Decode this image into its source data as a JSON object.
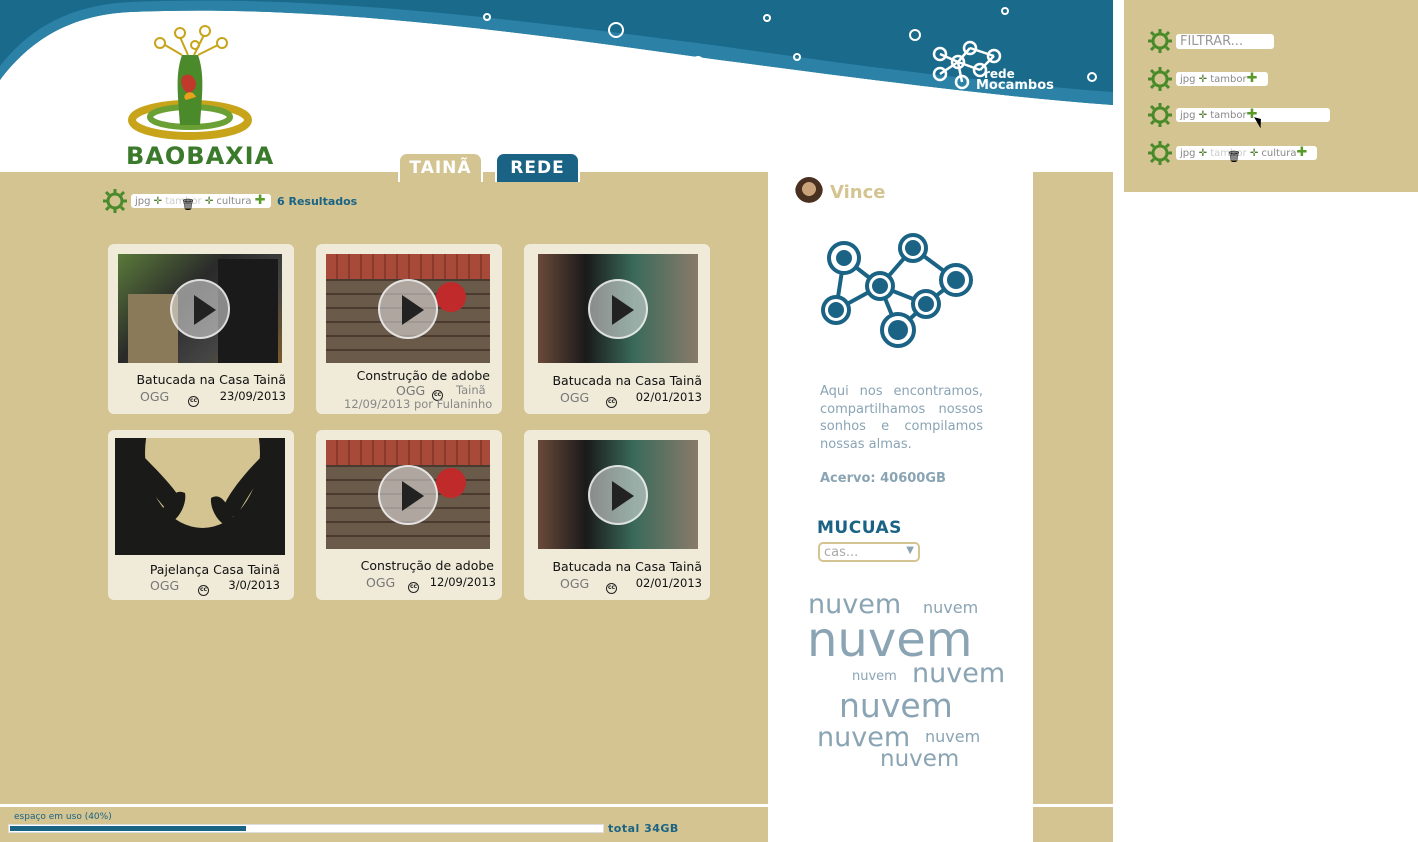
{
  "logo": {
    "text": "BAOBAXIA"
  },
  "network_logo": {
    "line1": "rede",
    "line2": "Mocambos"
  },
  "tabs": [
    {
      "label": "TAINÃ"
    },
    {
      "label": "REDE"
    }
  ],
  "filter_bar": {
    "chips": [
      "jpg",
      "tambor",
      "cultura"
    ],
    "results": "6 Resultados"
  },
  "cards": [
    {
      "title": "Batucada na Casa Tainã",
      "format": "OGG",
      "license": "cc",
      "date": "23/09/2013",
      "thumb": "drum-players",
      "has_play": true
    },
    {
      "title": "Construção de adobe",
      "format": "OGG",
      "license": "cc",
      "place": "Tainã",
      "byline": "12/09/2013 por Fulaninho",
      "thumb": "adobe-wall",
      "has_play": true
    },
    {
      "title": "Batucada na Casa Tainã",
      "format": "OGG",
      "license": "cc",
      "date": "02/01/2013",
      "thumb": "group-people",
      "has_play": true
    },
    {
      "title": "Pajelança Casa Tainã",
      "format": "OGG",
      "license": "cc",
      "date": "3/0/2013",
      "thumb": "hands-moon",
      "has_play": false
    },
    {
      "title": "Construção de adobe",
      "format": "OGG",
      "license": "cc",
      "date": "12/09/2013",
      "thumb": "adobe-wall",
      "has_play": true
    },
    {
      "title": "Batucada na Casa Tainã",
      "format": "OGG",
      "license": "cc",
      "date": "02/01/2013",
      "thumb": "group-people",
      "has_play": true
    }
  ],
  "sidebar": {
    "user": "Vince",
    "description": "Aqui nos encontramos, compartilhamos nossos sonhos e compilamos nossas almas.",
    "acervo": "Acervo: 40600GB",
    "mucuas_heading": "MUCUAS",
    "mucuas_placeholder": "cas...",
    "cloud_word": "nuvem"
  },
  "storage": {
    "label": "espaço em uso (40%)",
    "percent": 40,
    "total": "total 34GB"
  },
  "filter_panel": {
    "placeholder": "FILTRAR...",
    "row2": [
      "jpg",
      "tambor"
    ],
    "row3": [
      "jpg",
      "tambor"
    ],
    "row4": [
      "jpg",
      "tambor",
      "cultura"
    ]
  },
  "colors": {
    "khaki": "#d3c491",
    "blue": "#1b6384",
    "green": "#5a8a2a",
    "grey_blue": "#8aa4b4"
  }
}
